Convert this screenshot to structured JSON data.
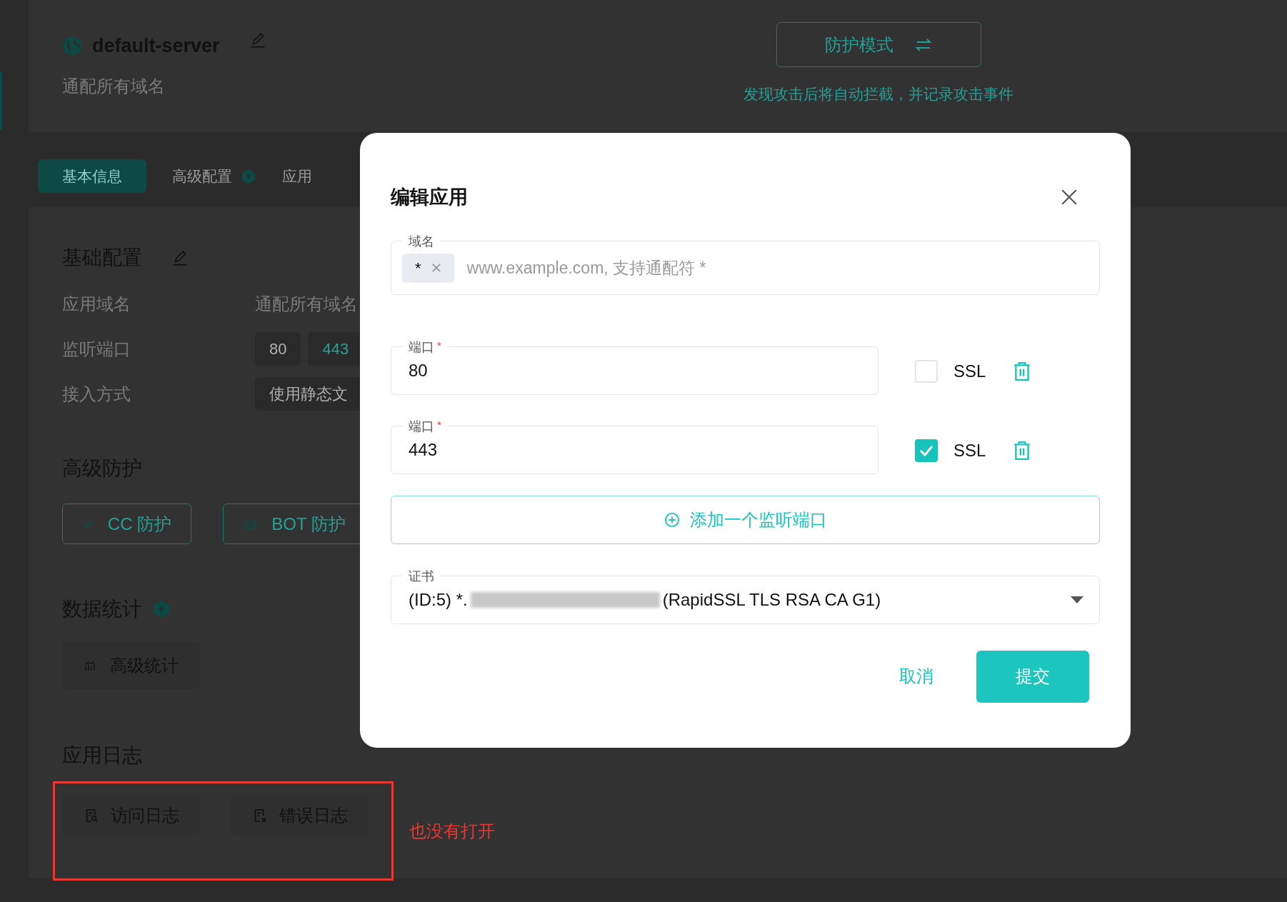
{
  "header": {
    "title": "default-server",
    "subtitle": "通配所有域名",
    "mode_button": "防护模式",
    "mode_hint": "发现攻击后将自动拦截，并记录攻击事件"
  },
  "tabs": [
    {
      "label": "基本信息",
      "selected": true,
      "pro": false
    },
    {
      "label": "高级配置",
      "selected": false,
      "pro": true
    },
    {
      "label": "应用",
      "selected": false,
      "pro": false
    }
  ],
  "basic": {
    "title": "基础配置",
    "rows": [
      {
        "label": "应用域名",
        "kind": "text",
        "values": [
          {
            "text": "通配所有域名",
            "ssl": false
          }
        ]
      },
      {
        "label": "监听端口",
        "kind": "chips",
        "values": [
          {
            "text": "80",
            "ssl": false
          },
          {
            "text": "443",
            "ssl": true
          }
        ]
      },
      {
        "label": "接入方式",
        "kind": "chips",
        "values": [
          {
            "text": "使用静态文",
            "ssl": false
          }
        ]
      }
    ]
  },
  "protection": {
    "title": "高级防护",
    "buttons": [
      {
        "label": "CC 防护",
        "kind": "cc"
      },
      {
        "label": "BOT 防护",
        "kind": "bot"
      }
    ]
  },
  "stats": {
    "title": "数据统计",
    "pro": true,
    "buttons": [
      {
        "label": "高级统计",
        "kind": "chart"
      }
    ]
  },
  "logs": {
    "title": "应用日志",
    "buttons": [
      {
        "label": "访问日志",
        "kind": "access"
      },
      {
        "label": "错误日志",
        "kind": "error"
      }
    ]
  },
  "annotation": {
    "text": "也没有打开"
  },
  "dialog": {
    "title": "编辑应用",
    "domain_field": {
      "label": "域名",
      "tags": [
        {
          "text": "*"
        }
      ],
      "placeholder": "www.example.com, 支持通配符 *"
    },
    "ports": [
      {
        "label": "端口",
        "required_mark": "*",
        "value": "80",
        "ssl_label": "SSL",
        "checked": false
      },
      {
        "label": "端口",
        "required_mark": "*",
        "value": "443",
        "ssl_label": "SSL",
        "checked": true
      }
    ],
    "add_button": "添加一个监听端口",
    "cert_field": {
      "label": "证书",
      "value_prefix": "(ID:5) *.",
      "value_suffix": "(RapidSSL TLS RSA CA G1)"
    },
    "cancel": "取消",
    "submit": "提交"
  }
}
